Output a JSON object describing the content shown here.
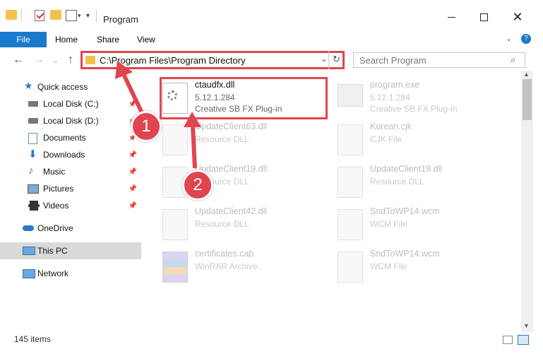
{
  "window": {
    "title": "Program"
  },
  "ribbon": {
    "file": "File",
    "home": "Home",
    "share": "Share",
    "view": "View"
  },
  "nav": {
    "address": "C:\\Program Files\\Program Directory",
    "search_placeholder": "Search Program"
  },
  "sidebar": {
    "items": [
      {
        "label": "Quick access",
        "icon": "star-icon"
      },
      {
        "label": "Local Disk (C:)",
        "icon": "drive-icon",
        "pinned": true
      },
      {
        "label": "Local Disk (D:)",
        "icon": "drive-icon",
        "pinned": true
      },
      {
        "label": "Documents",
        "icon": "documents-icon",
        "pinned": true
      },
      {
        "label": "Downloads",
        "icon": "downloads-icon",
        "pinned": true
      },
      {
        "label": "Music",
        "icon": "music-icon",
        "pinned": true
      },
      {
        "label": "Pictures",
        "icon": "pictures-icon",
        "pinned": true
      },
      {
        "label": "Videos",
        "icon": "videos-icon",
        "pinned": true
      },
      {
        "label": "OneDrive",
        "icon": "cloud-icon"
      },
      {
        "label": "This PC",
        "icon": "computer-icon"
      },
      {
        "label": "Network",
        "icon": "network-icon"
      }
    ]
  },
  "files": [
    {
      "name": "ctaudfx.dll",
      "line2": "5.12.1.284",
      "line3": "Creative SB FX Plug-in"
    },
    {
      "name": "program.exe",
      "line2": "5.12.1.284",
      "line3": "Creative SB FX Plug-in"
    },
    {
      "name": "UpdateClient63.dll",
      "line2": "Resource DLL"
    },
    {
      "name": "Korean.cjk",
      "line2": "CJK File"
    },
    {
      "name": "UpdateClient19.dll",
      "line2": "Resource DLL"
    },
    {
      "name": "UpdateClient19.dll",
      "line2": "Resource DLL"
    },
    {
      "name": "UpdateClient42.dll",
      "line2": "Resource DLL"
    },
    {
      "name": "SndToWP14.wcm",
      "line2": "WCM File"
    },
    {
      "name": "certificates.cab",
      "line2": "WinRAR Archive"
    },
    {
      "name": "SndToWP14.wcm",
      "line2": "WCM File"
    }
  ],
  "status": {
    "items": "145 items"
  },
  "callouts": {
    "one": "1",
    "two": "2"
  },
  "colors": {
    "accent": "#1979ca",
    "highlight": "#e0454f"
  }
}
